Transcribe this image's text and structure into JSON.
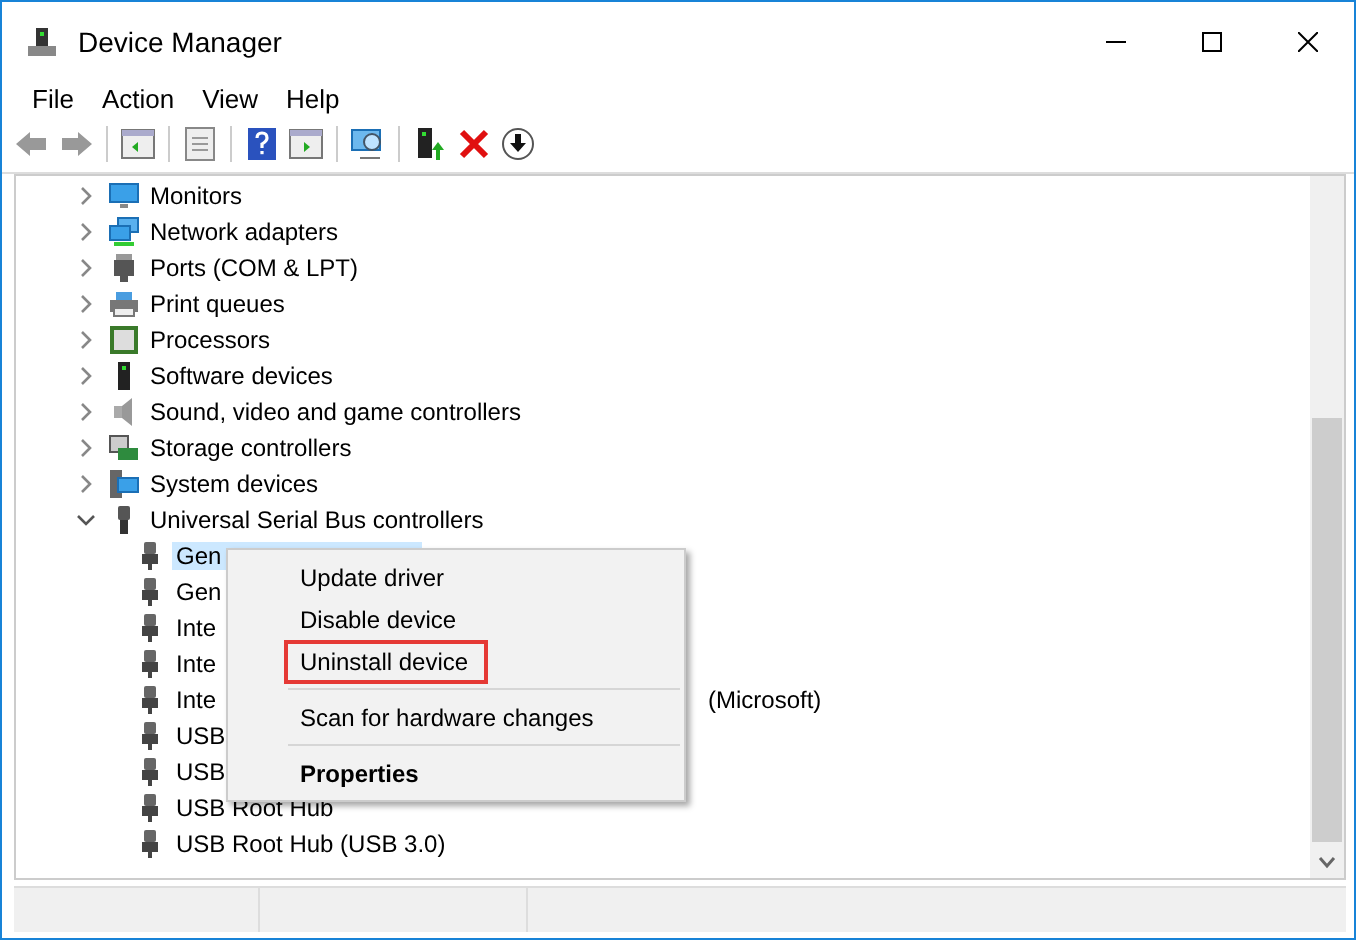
{
  "window": {
    "title": "Device Manager"
  },
  "menu_bar": [
    "File",
    "Action",
    "View",
    "Help"
  ],
  "tree": [
    {
      "label": "Monitors",
      "expanded": false
    },
    {
      "label": "Network adapters",
      "expanded": false
    },
    {
      "label": "Ports (COM & LPT)",
      "expanded": false
    },
    {
      "label": "Print queues",
      "expanded": false
    },
    {
      "label": "Processors",
      "expanded": false
    },
    {
      "label": "Software devices",
      "expanded": false
    },
    {
      "label": "Sound, video and game controllers",
      "expanded": false
    },
    {
      "label": "Storage controllers",
      "expanded": false
    },
    {
      "label": "System devices",
      "expanded": false
    },
    {
      "label": "Universal Serial Bus controllers",
      "expanded": true,
      "children": [
        {
          "label": "Gen",
          "selected": true
        },
        {
          "label": "Gen",
          "selected": false
        },
        {
          "label": "Inte",
          "selected": false
        },
        {
          "label": "Inte",
          "selected": false
        },
        {
          "label": "Inte",
          "tail": "(Microsoft)",
          "selected": false
        },
        {
          "label": "USB",
          "selected": false
        },
        {
          "label": "USB",
          "selected": false
        },
        {
          "label": "USB Root Hub",
          "selected": false
        },
        {
          "label": "USB Root Hub (USB 3.0)",
          "selected": false
        }
      ]
    }
  ],
  "context_menu": [
    {
      "kind": "item",
      "label": "Update driver",
      "highlighted": false
    },
    {
      "kind": "item",
      "label": "Disable device",
      "highlighted": false
    },
    {
      "kind": "item",
      "label": "Uninstall device",
      "highlighted": true
    },
    {
      "kind": "separator"
    },
    {
      "kind": "item",
      "label": "Scan for hardware changes",
      "highlighted": false
    },
    {
      "kind": "separator"
    },
    {
      "kind": "default",
      "label": "Properties",
      "highlighted": false
    }
  ]
}
